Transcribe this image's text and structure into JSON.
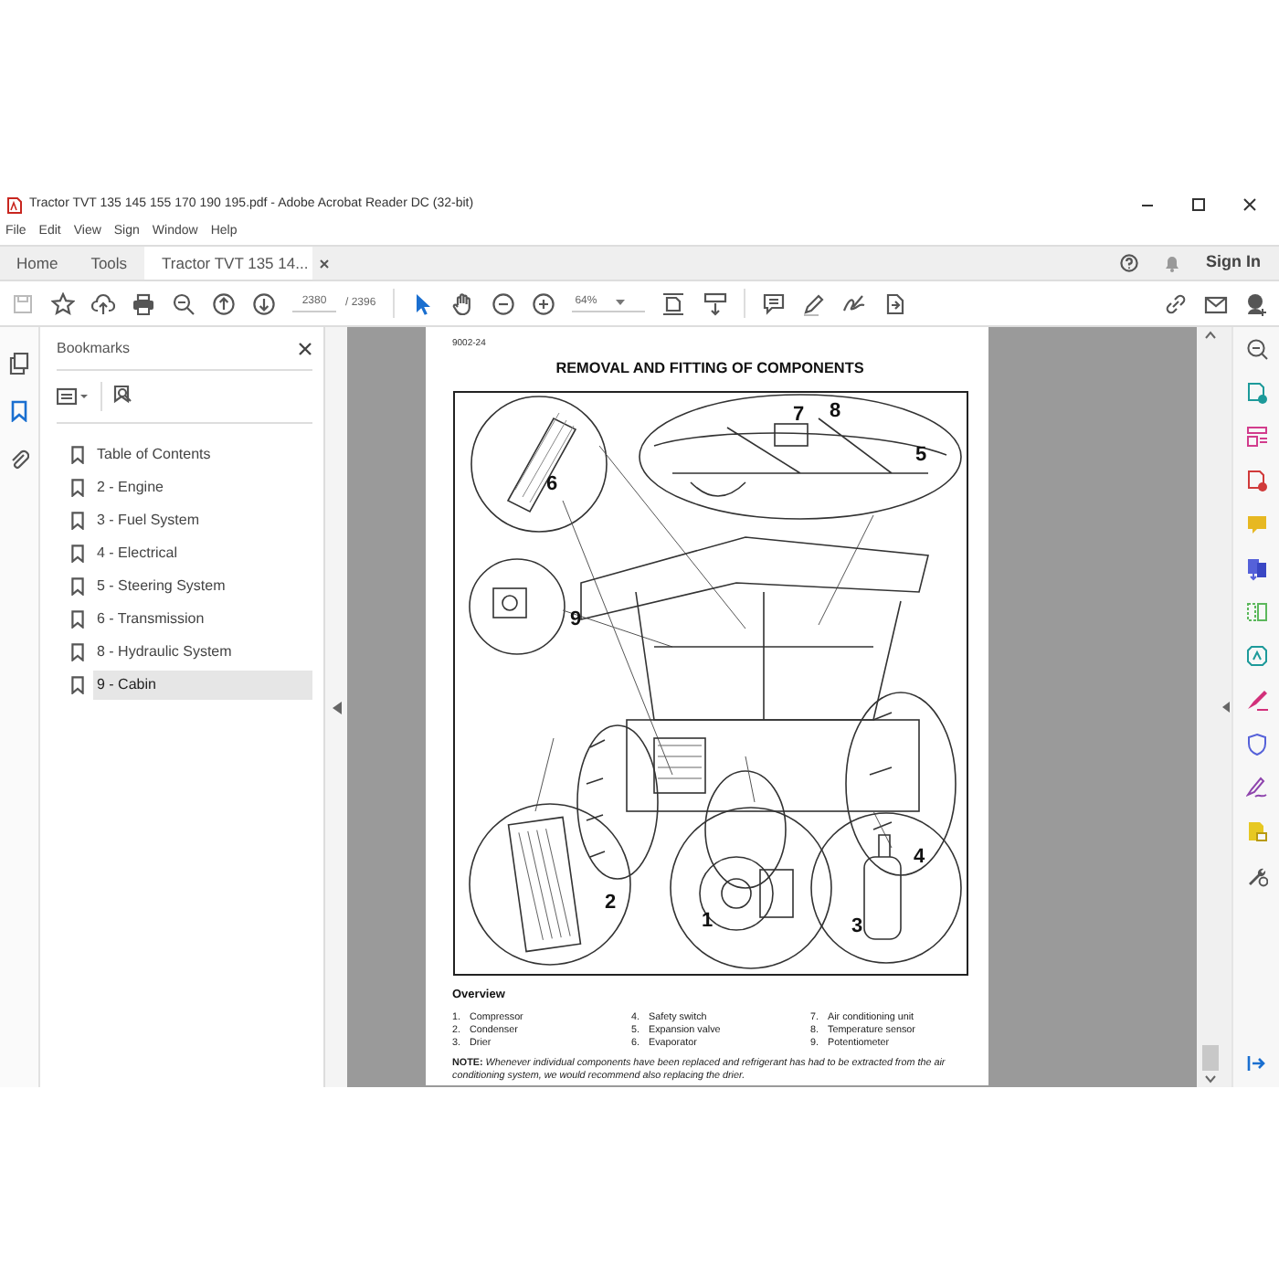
{
  "window": {
    "title": "Tractor TVT 135 145 155 170 190 195.pdf - Adobe Acrobat Reader DC (32-bit)"
  },
  "menu": [
    "File",
    "Edit",
    "View",
    "Sign",
    "Window",
    "Help"
  ],
  "tabs": [
    {
      "label": "Home",
      "selected": false
    },
    {
      "label": "Tools",
      "selected": false
    },
    {
      "label": "Tractor TVT 135 14...",
      "selected": true
    }
  ],
  "account": {
    "sign_in": "Sign In"
  },
  "toolbar": {
    "page_current": "2380",
    "page_total": "/ 2396",
    "zoom": "64%"
  },
  "bookmarks": {
    "title": "Bookmarks",
    "items": [
      {
        "label": "Table of Contents",
        "selected": false
      },
      {
        "label": "2 - Engine",
        "selected": false
      },
      {
        "label": "3 - Fuel System",
        "selected": false
      },
      {
        "label": "4 - Electrical",
        "selected": false
      },
      {
        "label": "5 - Steering System",
        "selected": false
      },
      {
        "label": "6 - Transmission",
        "selected": false
      },
      {
        "label": "8 - Hydraulic System",
        "selected": false
      },
      {
        "label": "9 - Cabin",
        "selected": true
      }
    ]
  },
  "page": {
    "code": "9002-24",
    "heading": "REMOVAL AND FITTING OF COMPONENTS",
    "callouts": [
      "7",
      "8",
      "5",
      "6",
      "9",
      "2",
      "1",
      "4",
      "3"
    ],
    "overview_title": "Overview",
    "components": [
      {
        "number": "1.",
        "name": "Compressor"
      },
      {
        "number": "2.",
        "name": "Condenser"
      },
      {
        "number": "3.",
        "name": "Drier"
      },
      {
        "number": "4.",
        "name": "Safety switch"
      },
      {
        "number": "5.",
        "name": "Expansion valve"
      },
      {
        "number": "6.",
        "name": "Evaporator"
      },
      {
        "number": "7.",
        "name": "Air conditioning unit"
      },
      {
        "number": "8.",
        "name": "Temperature sensor"
      },
      {
        "number": "9.",
        "name": "Potentiometer"
      }
    ],
    "note": "**NOTE:** *Whenever individual components have been replaced and refrigerant has had to be extracted from the air conditioning system, we would recommend also replacing the drier.*"
  }
}
